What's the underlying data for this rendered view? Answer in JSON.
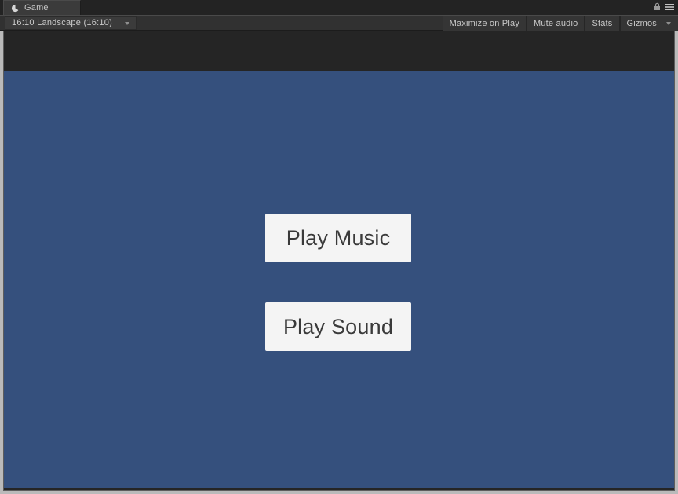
{
  "window": {
    "tab": {
      "label": "Game",
      "icon": "game-pacman-icon"
    },
    "icons": {
      "lock": "lock-icon",
      "menu": "hamburger-menu-icon"
    }
  },
  "toolbar": {
    "aspect_ratio": {
      "value": "16:10 Landscape (16:10)",
      "caret": "chevron-down-icon"
    },
    "buttons": [
      {
        "label": "Maximize on Play",
        "name": "maximize-on-play-button"
      },
      {
        "label": "Mute audio",
        "name": "mute-audio-button"
      },
      {
        "label": "Stats",
        "name": "stats-button"
      }
    ],
    "gizmos": {
      "label": "Gizmos",
      "caret": "chevron-down-icon"
    }
  },
  "game": {
    "background_color": "#35507d",
    "letterbox_color": "#252525",
    "buttons": [
      {
        "label": "Play Music",
        "name": "play-music-button",
        "text_color": "#3a3a3a",
        "background_color": "#f4f4f4"
      },
      {
        "label": "Play Sound",
        "name": "play-sound-button",
        "text_color": "#3a3a3a",
        "background_color": "#f4f4f4"
      }
    ]
  }
}
